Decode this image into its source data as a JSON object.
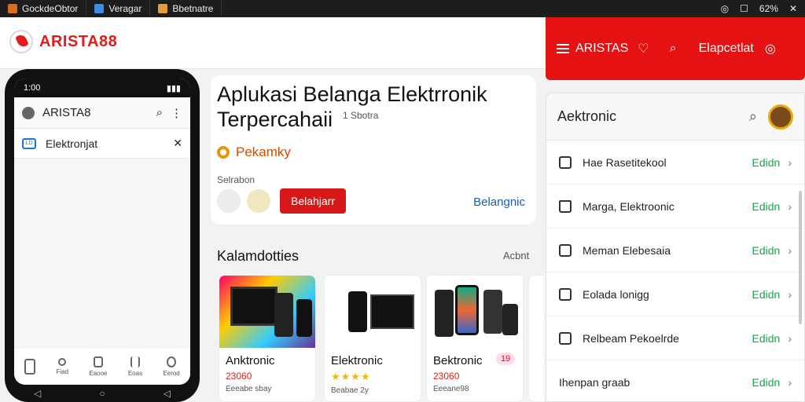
{
  "os": {
    "tabs": [
      {
        "label": "GockdeObtor",
        "icon": "app-icon",
        "color": "#e06a1a"
      },
      {
        "label": "Veragar",
        "icon": "browser-icon",
        "color": "#3a8ee6"
      },
      {
        "label": "Bbetnatre",
        "icon": "folder-icon",
        "color": "#e0a030"
      }
    ],
    "battery": "62%"
  },
  "header": {
    "logo_text": "ARISTA88"
  },
  "red_bar": {
    "brand": "ARISTAS",
    "account_label": "Elapcetlat",
    "color": "#e41212"
  },
  "phone": {
    "time": "1:00",
    "app_title": "ARISTA8",
    "search_value": "Elektronjat",
    "search_badge": "LD",
    "nav": [
      "Fiad",
      "Eaooe",
      "Eoas",
      "Eerod"
    ]
  },
  "hero": {
    "title_line1": "Aplukasi Belanga Elektrronik",
    "title_line2": "Terpercahaii",
    "sub": "1 Sbotra",
    "tag": "Pekamky",
    "label": "Selrabon",
    "button": "Belahjarr",
    "link": "Belangnic"
  },
  "categories": {
    "title": "Kalamdotties",
    "more": "Acbnt",
    "cards": [
      {
        "name": "Anktronic",
        "price": "23060",
        "meta": "Eeeabe sbay"
      },
      {
        "name": "Elektronic",
        "stars": "★★★★",
        "meta": "Beabae 2y"
      },
      {
        "name": "Bektronic",
        "price": "23060",
        "meta": "Eeeane98",
        "badge": "19"
      }
    ]
  },
  "panel": {
    "title": "Aektronic",
    "rows": [
      {
        "label": "Hae Rasetitekool",
        "action": "Edidn"
      },
      {
        "label": "Marga, Elektroonic",
        "action": "Edidn"
      },
      {
        "label": "Meman Elebesaia",
        "action": "Edidn"
      },
      {
        "label": "Eolada lonigg",
        "action": "Edidn"
      },
      {
        "label": "Relbeam Pekoelrde",
        "action": "Edidn"
      },
      {
        "label": "Ihenpan graab",
        "action": "Edidn"
      }
    ],
    "action_color": "#1aa351"
  }
}
